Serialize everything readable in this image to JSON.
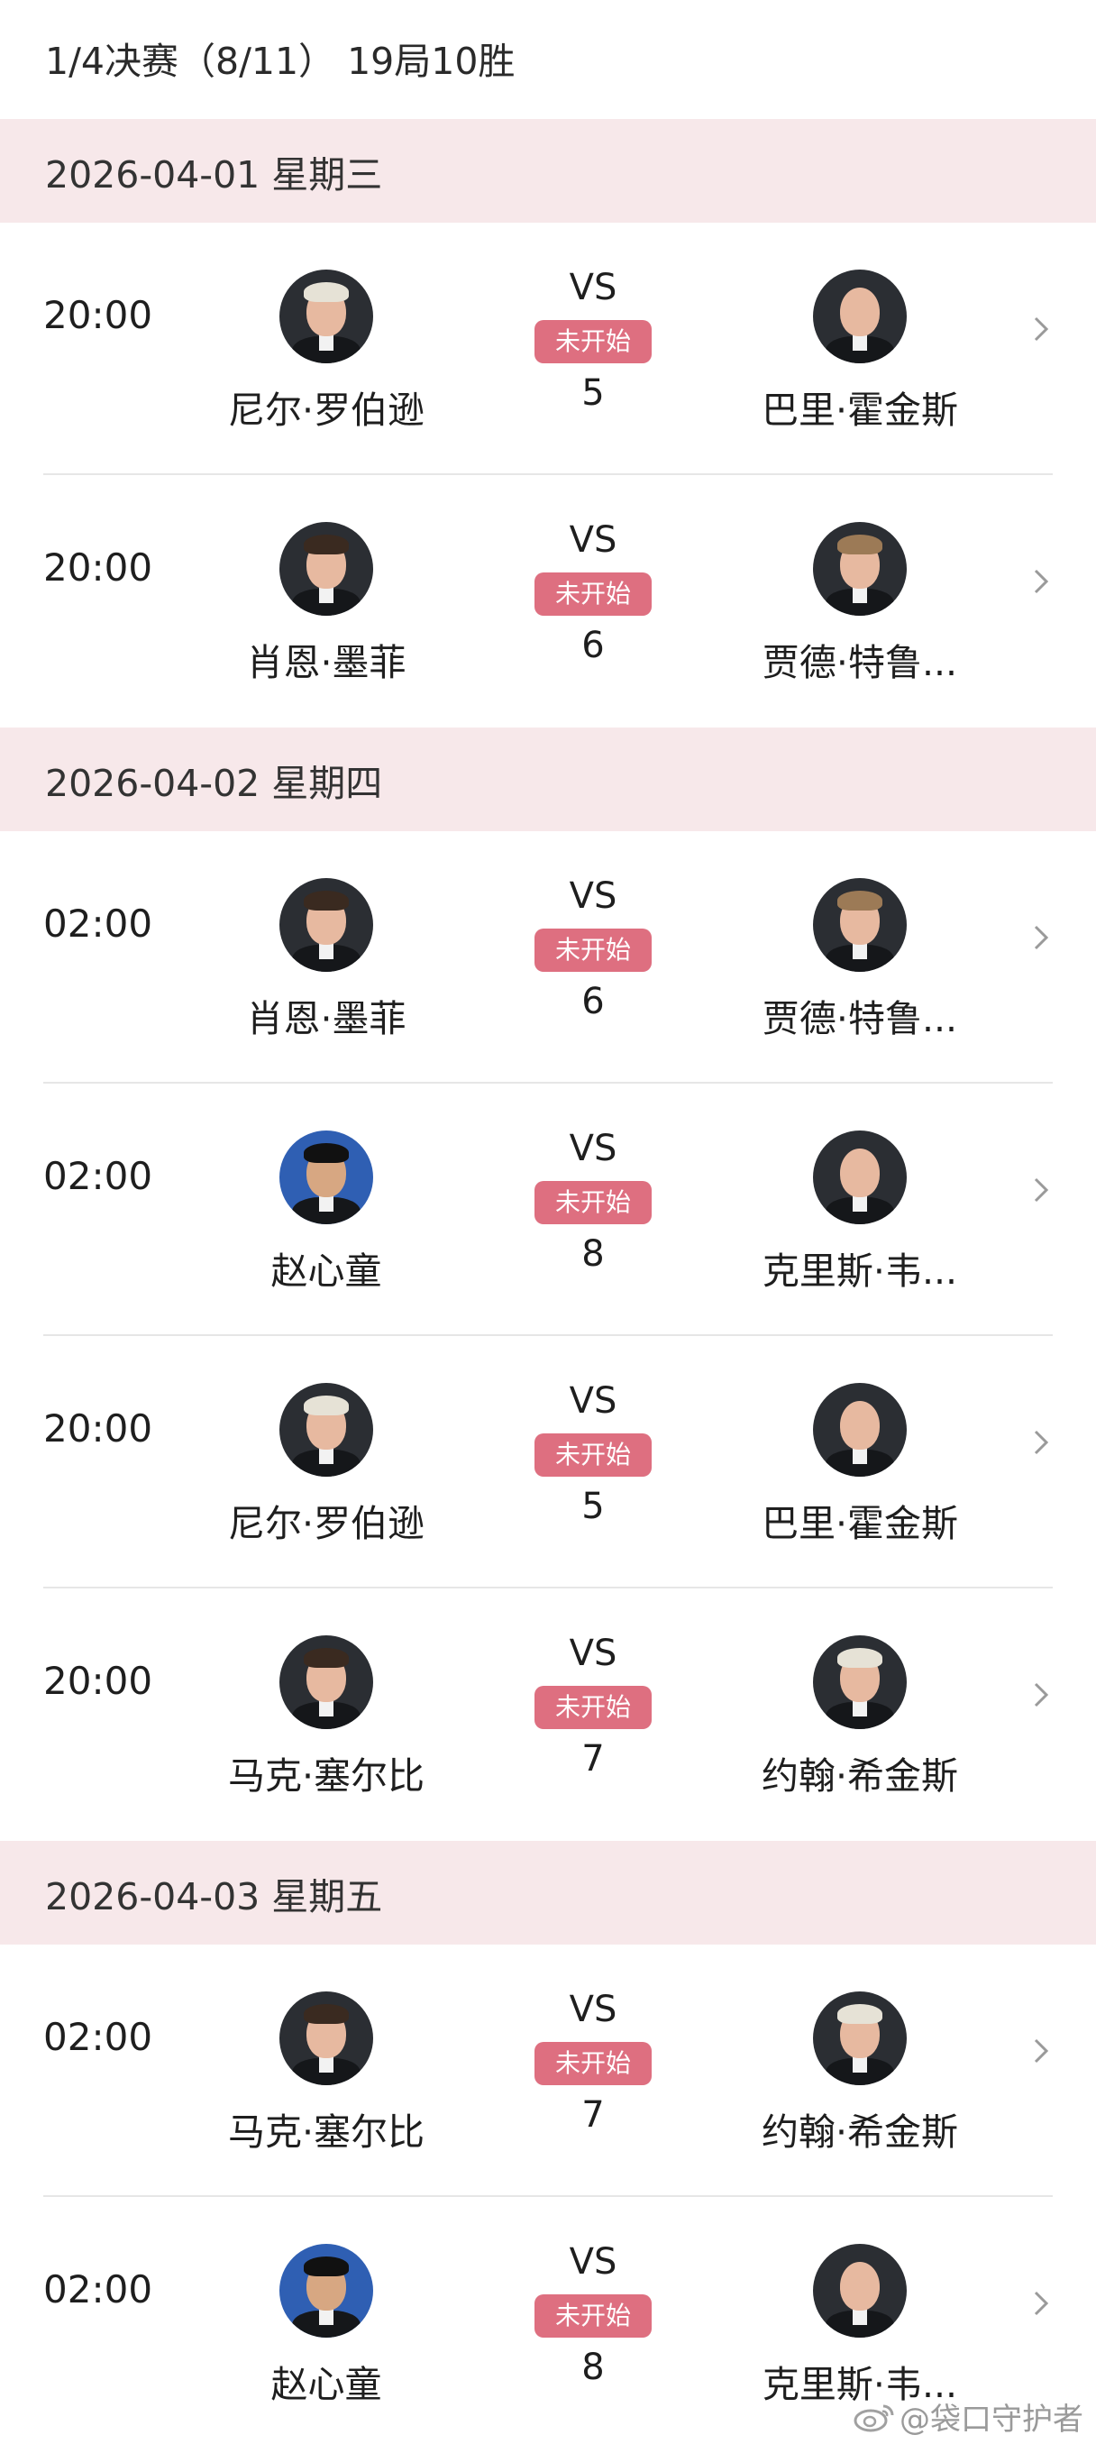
{
  "header": {
    "title": "1/4决赛（8/11） 19局10胜"
  },
  "days": [
    {
      "date": "2026-04-01 星期三",
      "matches": [
        {
          "time": "20:00",
          "vs": "VS",
          "status": "未开始",
          "frames": "5",
          "p1": {
            "name": "尼尔·罗伯逊",
            "avatar": "light-hair"
          },
          "p2": {
            "name": "巴里·霍金斯",
            "avatar": "bald"
          }
        },
        {
          "time": "20:00",
          "vs": "VS",
          "status": "未开始",
          "frames": "6",
          "p1": {
            "name": "肖恩·墨菲",
            "avatar": "dark"
          },
          "p2": {
            "name": "贾德·特鲁...",
            "avatar": "blond"
          }
        }
      ]
    },
    {
      "date": "2026-04-02 星期四",
      "matches": [
        {
          "time": "02:00",
          "vs": "VS",
          "status": "未开始",
          "frames": "6",
          "p1": {
            "name": "肖恩·墨菲",
            "avatar": "dark"
          },
          "p2": {
            "name": "贾德·特鲁...",
            "avatar": "blond"
          }
        },
        {
          "time": "02:00",
          "vs": "VS",
          "status": "未开始",
          "frames": "8",
          "p1": {
            "name": "赵心童",
            "avatar": "blue"
          },
          "p2": {
            "name": "克里斯·韦...",
            "avatar": "bald"
          }
        },
        {
          "time": "20:00",
          "vs": "VS",
          "status": "未开始",
          "frames": "5",
          "p1": {
            "name": "尼尔·罗伯逊",
            "avatar": "light-hair"
          },
          "p2": {
            "name": "巴里·霍金斯",
            "avatar": "bald"
          }
        },
        {
          "time": "20:00",
          "vs": "VS",
          "status": "未开始",
          "frames": "7",
          "p1": {
            "name": "马克·塞尔比",
            "avatar": "dark"
          },
          "p2": {
            "name": "约翰·希金斯",
            "avatar": "light-hair"
          }
        }
      ]
    },
    {
      "date": "2026-04-03 星期五",
      "matches": [
        {
          "time": "02:00",
          "vs": "VS",
          "status": "未开始",
          "frames": "7",
          "p1": {
            "name": "马克·塞尔比",
            "avatar": "dark"
          },
          "p2": {
            "name": "约翰·希金斯",
            "avatar": "light-hair"
          }
        },
        {
          "time": "02:00",
          "vs": "VS",
          "status": "未开始",
          "frames": "8",
          "p1": {
            "name": "赵心童",
            "avatar": "blue"
          },
          "p2": {
            "name": "克里斯·韦...",
            "avatar": "bald"
          }
        }
      ]
    }
  ],
  "watermark": {
    "text": "@袋口守护者",
    "icon": "weibo-icon"
  },
  "colors": {
    "date_header_bg": "#f7e8ea",
    "status_badge": "#de6f80",
    "divider": "#e6e6e6"
  }
}
